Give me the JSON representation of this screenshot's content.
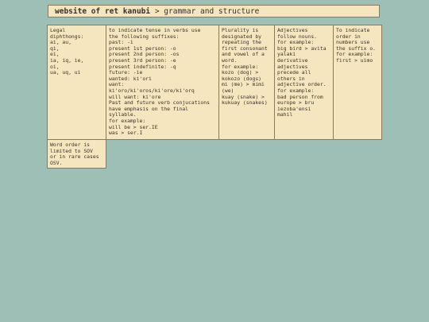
{
  "header": {
    "site": "website of ret kanubi",
    "separator": " > ",
    "page": "grammar and structure"
  },
  "notes": [
    {
      "name": "note-diphthongs",
      "text": "Legal\ndiphthongs:\nai, au,\nqi,\nei,\nia, iq, ie,\noi,\nua, uq, ui"
    },
    {
      "name": "note-verb-tense",
      "text": "to indicate tense in verbs use\nthe following suffixes:\npast: -i\npresent 1st person: -o\npresent 2nd person: -os\npresent 3rd person: -e\npresent indefinite: -q\nfuture: -ie\nwanted: ki'ori\nwant:\nki'oro/ki'oros/ki'ore/ki'orq\nwill want: ki'ore\nPast and future verb conjucations\nhave emphasis on the final\nsyllable.\nfor example:\nwill be > ser.IE\nwas > ser.I"
    },
    {
      "name": "note-plurality",
      "text": "Plurality is\ndesignated by\nrepeating the\nfirst consonant\nand vowel of a\nword.\nfor example:\nkozo (dog) >\nkokozo (dogs)\nmi (me) > mimi\n(we)\nkuay (snake) >\nkukuay (snakes)"
    },
    {
      "name": "note-adjectives",
      "text": "Adjectives\nfollow nouns.\nfor example:\nbig bird > avita\nyalaki\nderivative\nadjectives\nprecede all\nothers in\nadjective order.\nfor example:\nbad person from\neurope > bru\niezoba'ensi\nmahil"
    },
    {
      "name": "note-order-suffix",
      "text": "To indicate\norder in\nnumbers use\nthe suffix o.\nfor example:\nfirst > uimo"
    },
    {
      "name": "note-word-order",
      "text": "Word order is\nlimited to SOV\nor in rare cases\nOSV."
    }
  ]
}
